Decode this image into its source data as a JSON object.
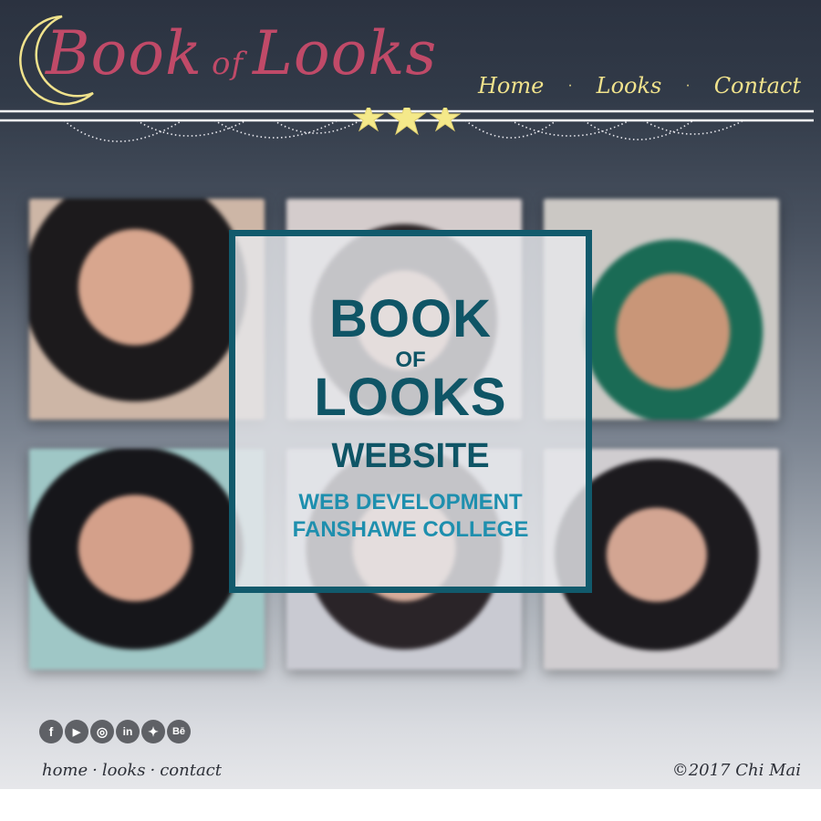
{
  "header": {
    "logo": {
      "word1": "Book",
      "word2": "of",
      "word3": "Looks"
    },
    "nav": [
      "Home",
      "Looks",
      "Contact"
    ],
    "nav_separator": "·"
  },
  "card": {
    "line1": "BOOK",
    "line2": "OF",
    "line3": "LOOKS",
    "line4": "WEBSITE",
    "sub1": "WEB DEVELOPMENT",
    "sub2": "FANSHAWE COLLEGE"
  },
  "photos": [
    {
      "name": "photo-1",
      "bg": "#d9c9bf",
      "hair": "#1c1a1c",
      "skin": "#d8a68e"
    },
    {
      "name": "photo-2",
      "bg": "#cfc8c8",
      "hair": "#2a2426",
      "skin": "#d9ab98"
    },
    {
      "name": "photo-3",
      "bg": "#c4c0bc",
      "hair": "#1a6b55",
      "skin": "#c99678"
    },
    {
      "name": "photo-4",
      "bg": "#c3c8cc",
      "hair": "#16161a",
      "skin": "#d4a08a"
    },
    {
      "name": "photo-5",
      "bg": "#c7c9d1",
      "hair": "#2a2428",
      "skin": "#d6ac9a"
    },
    {
      "name": "photo-6",
      "bg": "#c9c9cc",
      "hair": "#1c1a1e",
      "skin": "#d3a592"
    }
  ],
  "footer": {
    "social": [
      {
        "name": "facebook-icon",
        "glyph": "f"
      },
      {
        "name": "youtube-icon",
        "glyph": "▶"
      },
      {
        "name": "instagram-icon",
        "glyph": "◎"
      },
      {
        "name": "linkedin-icon",
        "glyph": "in"
      },
      {
        "name": "twitter-icon",
        "glyph": "✦"
      },
      {
        "name": "behance-icon",
        "glyph": "Bē"
      }
    ],
    "links": [
      "home",
      "looks",
      "contact"
    ],
    "link_separator": "·",
    "copyright": "©2017 Chi Mai"
  },
  "colors": {
    "accent": "#c04a68",
    "nav": "#f0e28c",
    "card_border": "#115a6c",
    "card_title": "#0f5566",
    "card_sub": "#1e8fae"
  }
}
